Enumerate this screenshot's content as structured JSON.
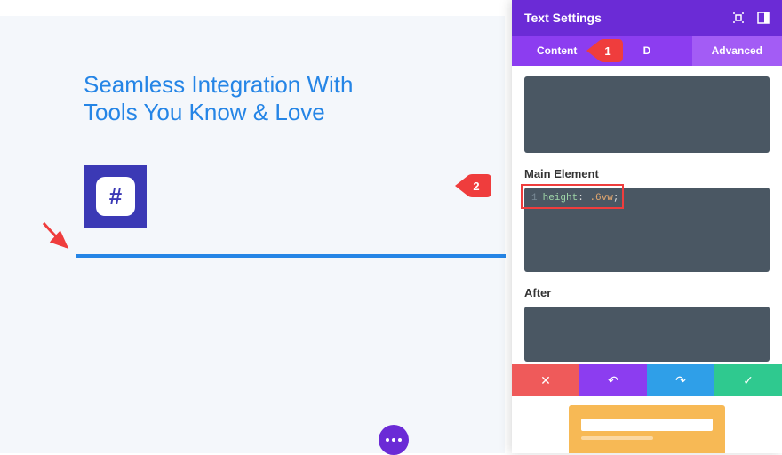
{
  "canvas": {
    "heading": "Seamless Integration With Tools You Know & Love",
    "icon_glyph": "#"
  },
  "panel": {
    "title": "Text Settings",
    "tabs": {
      "content": "Content",
      "design_partial": "D",
      "advanced": "Advanced"
    },
    "fields": {
      "main_element_label": "Main Element",
      "after_label": "After"
    },
    "code": {
      "line_number": "1",
      "property": "height",
      "colon": ":",
      "value": ".6vw",
      "semicolon": ";"
    }
  },
  "callouts": {
    "one": "1",
    "two": "2"
  },
  "actions": {
    "cancel_glyph": "✕",
    "undo_glyph": "↶",
    "redo_glyph": "↷",
    "save_glyph": "✓"
  }
}
